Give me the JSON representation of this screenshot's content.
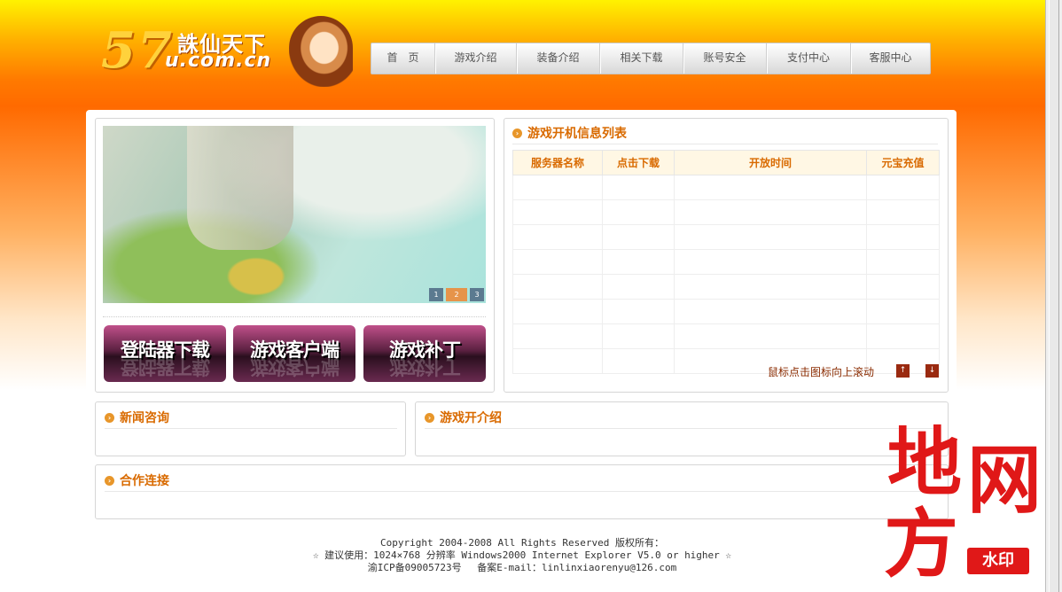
{
  "header": {
    "logo_number": "57",
    "logo_title": "誅仙天下",
    "logo_domain": "u.com.cn",
    "nav": [
      "首　页",
      "游戏介绍",
      "装备介绍",
      "相关下载",
      "账号安全",
      "支付中心",
      "客服中心"
    ]
  },
  "banner": {
    "pager": [
      "1",
      "2",
      "3"
    ],
    "active_page": "2"
  },
  "downloads": [
    "登陆器下载",
    "游戏客户端",
    "游戏补丁"
  ],
  "servers": {
    "title": "游戏开机信息列表",
    "columns": [
      "服务器名称",
      "点击下载",
      "开放时间",
      "元宝充值"
    ],
    "rows": [
      [
        "",
        "",
        "",
        ""
      ],
      [
        "",
        "",
        "",
        ""
      ],
      [
        "",
        "",
        "",
        ""
      ],
      [
        "",
        "",
        "",
        ""
      ],
      [
        "",
        "",
        "",
        ""
      ],
      [
        "",
        "",
        "",
        ""
      ],
      [
        "",
        "",
        "",
        ""
      ],
      [
        "",
        "",
        "",
        ""
      ]
    ],
    "scroll_tip": "鼠标点击图标向上滚动",
    "up_icon": "arrow-up-icon",
    "down_icon": "arrow-down-icon"
  },
  "news": {
    "title": "新闻咨询"
  },
  "intro": {
    "title": "游戏开介绍"
  },
  "partners": {
    "title": "合作连接"
  },
  "footer": {
    "line1": "Copyright 2004-2008 All Rights Reserved 版权所有：",
    "line2": "☆ 建议使用：1024×768 分辨率 Windows2000 Internet Explorer V5.0 or higher ☆",
    "line3": "渝ICP备09005723号　 备案E-mail：linlinxiaorenyu@126.com"
  },
  "watermark": {
    "chars": [
      "地",
      "网",
      "方"
    ],
    "stamp": "水印"
  },
  "colors": {
    "accent": "#d96a00",
    "header_top": "#fff200",
    "header_mid": "#ff6a00",
    "watermark": "#e01818"
  }
}
